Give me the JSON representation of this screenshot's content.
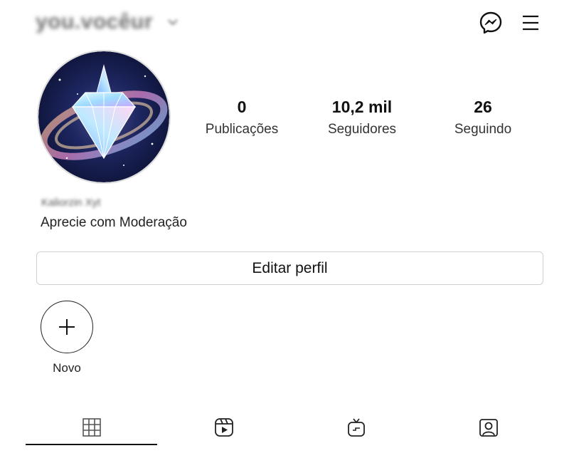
{
  "header": {
    "username": "you.vocêur",
    "icons": {
      "dropdown": "chevron-down-icon",
      "messenger": "messenger-icon",
      "menu": "hamburger-menu-icon"
    }
  },
  "profile": {
    "avatar_icon": "diamond-galaxy-avatar",
    "display_name": "Kaliorzin Xyt",
    "bio": "Aprecie com Moderação"
  },
  "stats": [
    {
      "value": "0",
      "label": "Publicações"
    },
    {
      "value": "10,2 mil",
      "label": "Seguidores"
    },
    {
      "value": "26",
      "label": "Seguindo"
    }
  ],
  "actions": {
    "edit_profile": "Editar perfil"
  },
  "highlights": {
    "new_label": "Novo",
    "new_icon": "plus-icon"
  },
  "tabs": [
    {
      "icon": "grid-icon",
      "active": true
    },
    {
      "icon": "reels-icon",
      "active": false
    },
    {
      "icon": "igtv-icon",
      "active": false
    },
    {
      "icon": "tagged-person-icon",
      "active": false
    }
  ],
  "colors": {
    "text": "#111111",
    "border": "#d0d0d0",
    "muted": "#6f6f6f"
  }
}
